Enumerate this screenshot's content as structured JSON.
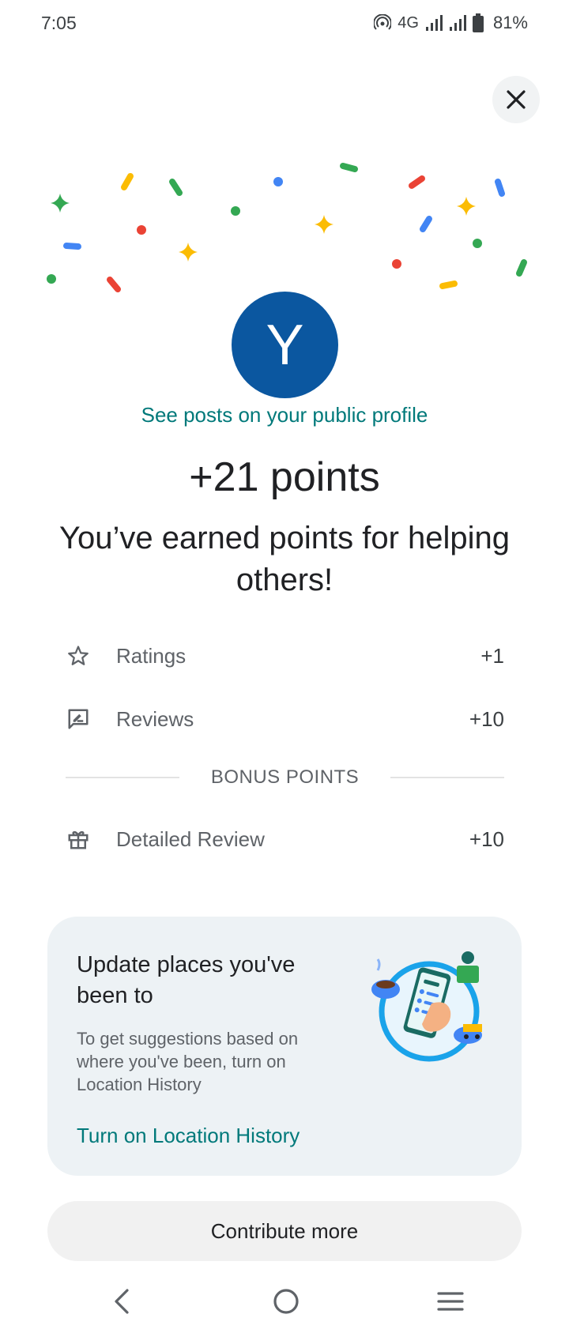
{
  "status_bar": {
    "time": "7:05",
    "network": "4G",
    "battery": "81%"
  },
  "celebration": {
    "avatar_letter": "Y",
    "public_profile_link": "See posts on your public profile",
    "points_title": "+21 points",
    "points_subtitle": "You’ve earned points for helping others!"
  },
  "breakdown": {
    "items": [
      {
        "icon": "star-outline-icon",
        "label": "Ratings",
        "value": "+1"
      },
      {
        "icon": "review-icon",
        "label": "Reviews",
        "value": "+10"
      }
    ],
    "bonus_header": "BONUS POINTS",
    "bonus_items": [
      {
        "icon": "gift-icon",
        "label": "Detailed Review",
        "value": "+10"
      }
    ]
  },
  "location_card": {
    "title": "Update places you've been to",
    "body": "To get suggestions based on where you've been, turn on Location History",
    "link": "Turn on Location History",
    "illustration": "phone-in-hand-illustration"
  },
  "contribute_button": "Contribute more",
  "colors": {
    "accent_teal": "#00797a",
    "avatar_blue": "#0b57a0",
    "card_bg": "#edf2f5",
    "confetti": [
      "#4285f4",
      "#ea4335",
      "#fbbc04",
      "#34a853"
    ]
  },
  "nav": {
    "back": "back-icon",
    "home": "home-icon",
    "recents": "recents-icon"
  }
}
